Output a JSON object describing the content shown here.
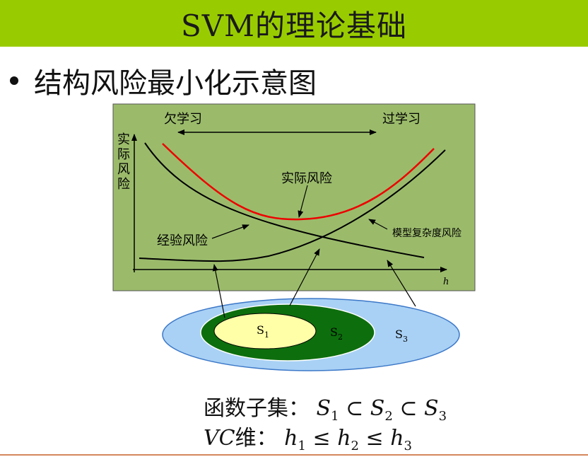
{
  "title": "SVM的理论基础",
  "bullet": "结构风险最小化示意图",
  "diagram": {
    "underfit_label": "欠学习",
    "overfit_label": "过学习",
    "y_axis_label": [
      "实",
      "际",
      "风",
      "险"
    ],
    "actual_risk_label": "实际风险",
    "empirical_risk_label": "经验风险",
    "complexity_label": "模型复杂度风险",
    "x_axis_label": "h",
    "sets": [
      {
        "label": "S",
        "sub": "1"
      },
      {
        "label": "S",
        "sub": "2"
      },
      {
        "label": "S",
        "sub": "3"
      }
    ]
  },
  "formula_line1": {
    "prefix": "函数子集：",
    "terms": [
      {
        "sym": "S",
        "sub": "1"
      },
      {
        "sym": "S",
        "sub": "2"
      },
      {
        "sym": "S",
        "sub": "3"
      }
    ],
    "op": "⊂"
  },
  "formula_line2": {
    "prefix_math": "VC",
    "prefix_rest": "维：",
    "terms": [
      {
        "sym": "h",
        "sub": "1"
      },
      {
        "sym": "h",
        "sub": "2"
      },
      {
        "sym": "h",
        "sub": "3"
      }
    ],
    "op": "≤"
  }
}
